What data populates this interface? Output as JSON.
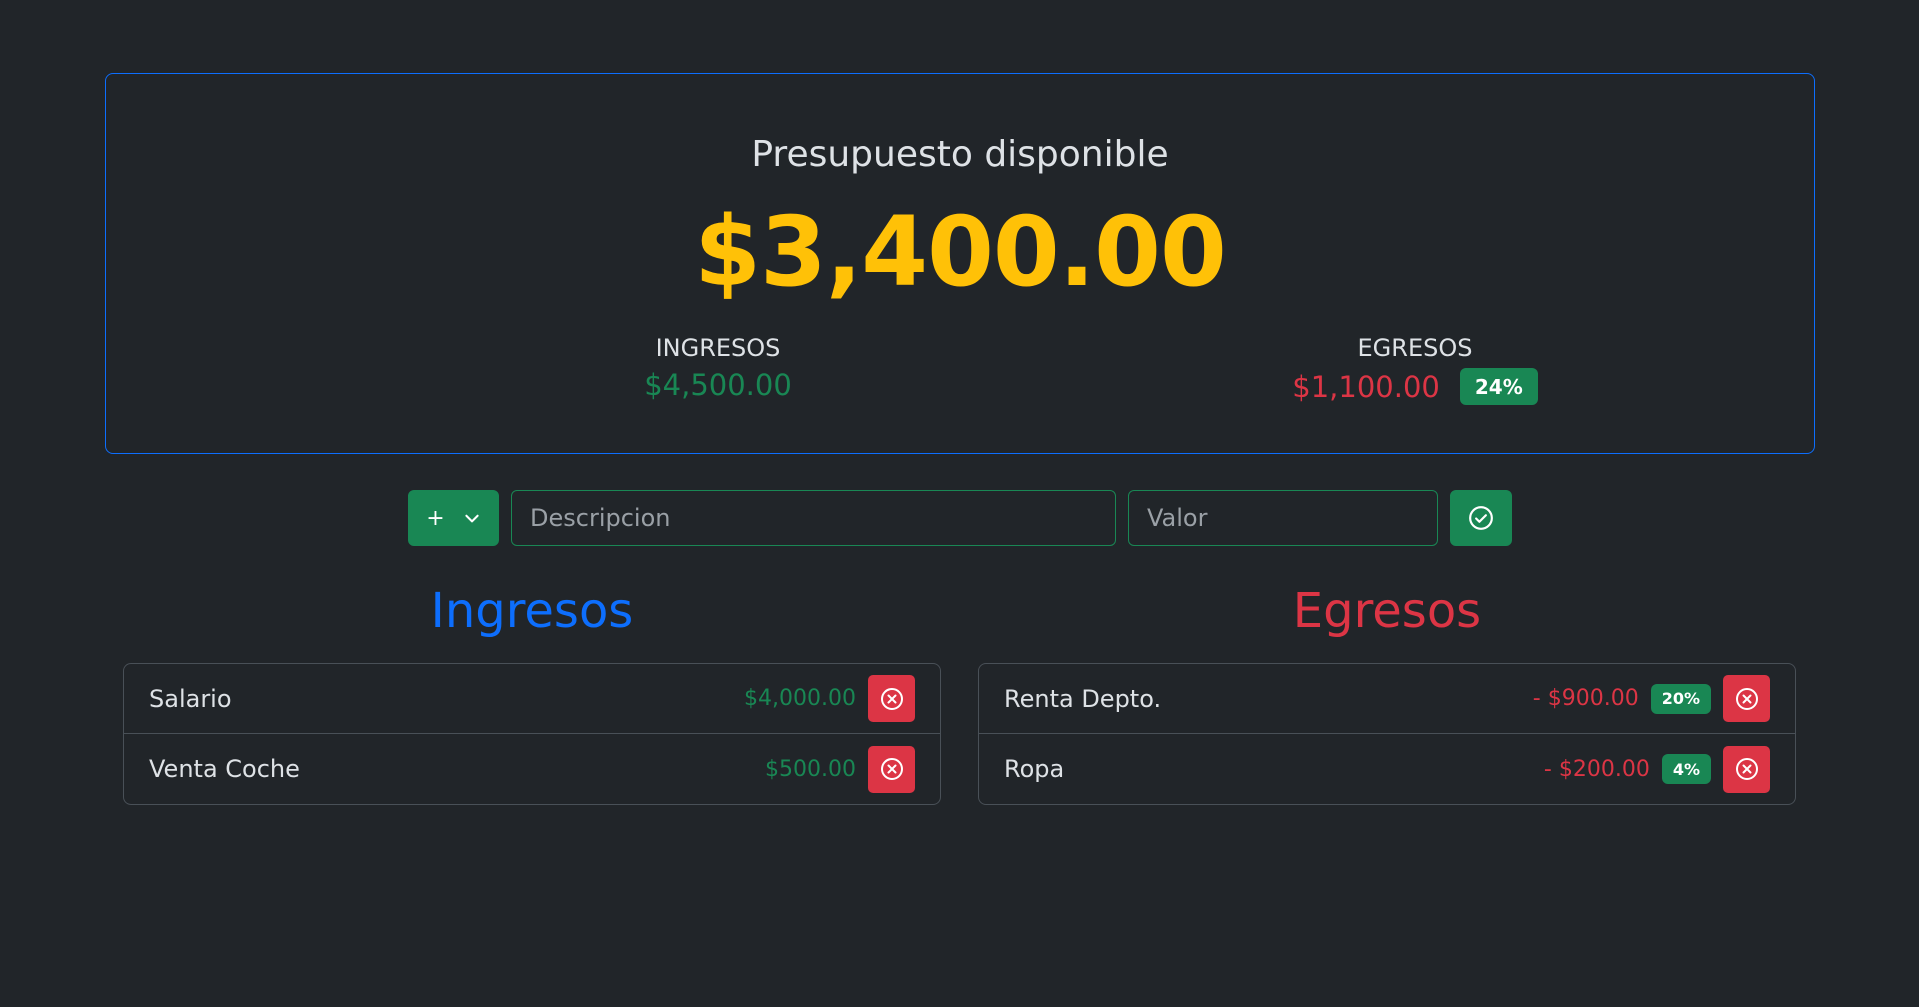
{
  "summary": {
    "title": "Presupuesto disponible",
    "amount": "$3,400.00",
    "income_label": "INGRESOS",
    "income_value": "$4,500.00",
    "expense_label": "EGRESOS",
    "expense_value": "$1,100.00",
    "expense_percent": "24%"
  },
  "form": {
    "type_label": "+",
    "description_placeholder": "Descripcion",
    "value_placeholder": "Valor"
  },
  "income": {
    "heading": "Ingresos",
    "items": [
      {
        "description": "Salario",
        "value": "$4,000.00"
      },
      {
        "description": "Venta Coche",
        "value": "$500.00"
      }
    ]
  },
  "expenses": {
    "heading": "Egresos",
    "items": [
      {
        "description": "Renta Depto.",
        "value": "- $900.00",
        "percent": "20%"
      },
      {
        "description": "Ropa",
        "value": "- $200.00",
        "percent": "4%"
      }
    ]
  },
  "colors": {
    "background": "#212529",
    "primary": "#0d6efd",
    "success": "#198754",
    "danger": "#dc3545",
    "warning": "#ffc107"
  },
  "icons": {
    "type_dropdown": "chevron-down-icon",
    "submit": "check-circle-icon",
    "delete": "x-circle-icon"
  }
}
